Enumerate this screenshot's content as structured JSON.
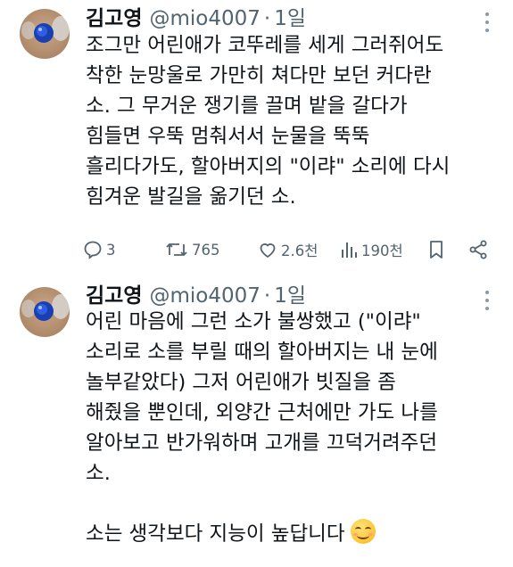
{
  "tweets": [
    {
      "author": {
        "name": "김고영",
        "handle": "@mio4007",
        "separator": "·",
        "time": "1일"
      },
      "lines": [
        "조그만 어린애가 코뚜레를 세게 그러쥐어도",
        "착한 눈망울로 가만히 쳐다만 보던 커다란",
        "소. 그 무거운 쟁기를 끌며 밭을 갈다가",
        "힘들면 우뚝 멈춰서서 눈물을 뚝뚝",
        "흘리다가도, 할아버지의 \"이랴\" 소리에 다시",
        "힘겨운 발길을 옮기던 소."
      ],
      "actions": {
        "replies": "3",
        "retweets": "765",
        "likes": "2.6천",
        "views": "190천"
      }
    },
    {
      "author": {
        "name": "김고영",
        "handle": "@mio4007",
        "separator": "·",
        "time": "1일"
      },
      "lines": [
        "어린 마음에 그런 소가 불쌍했고 (\"이랴\"",
        "소리로 소를 부릴 때의 할아버지는 내 눈에",
        "놀부같았다) 그저 어린애가 빗질을 좀",
        "해줬을 뿐인데, 외양간 근처에만 가도 나를",
        "알아보고 반가워하며 고개를 끄덕거려주던",
        "소."
      ],
      "last_line": "소는 생각보다 지능이 높답니다",
      "emoji": "smiling-face-icon"
    }
  ],
  "colors": {
    "text": "#0f1419",
    "secondary": "#536471",
    "background": "#ffffff"
  }
}
